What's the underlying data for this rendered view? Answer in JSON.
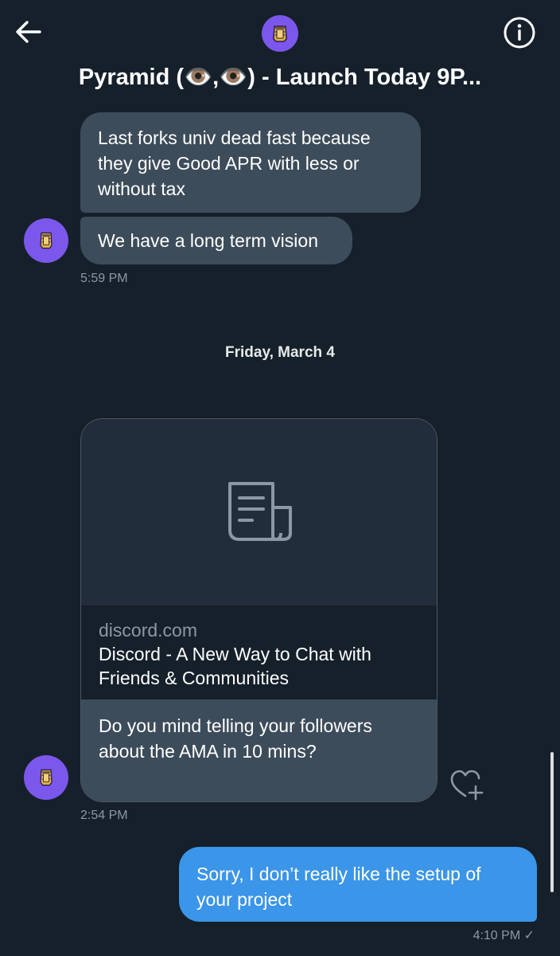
{
  "header": {
    "title": "Pyramid (👁️,👁️) - Launch Today 9P...",
    "back_icon": "arrow-left-icon",
    "info_icon": "info-icon"
  },
  "messages": {
    "m1_text": "Last forks univ dead fast because they give Good APR with less or without tax",
    "m2_text": "We have a long term vision",
    "m2_time": "5:59 PM",
    "day_separator": "Friday, March 4",
    "card": {
      "domain": "discord.com",
      "title": "Discord - A New Way to Chat with Friends & Communities",
      "message": "Do you mind telling your followers about the AMA in 10 mins?",
      "time": "2:54 PM",
      "icon": "document-icon"
    },
    "m3_text": "Sorry, I don’t really like the setup of your project",
    "m3_time": "4:10 PM ✓"
  },
  "colors": {
    "background": "#15202b",
    "incoming_bubble": "#3d4c5a",
    "outgoing_bubble": "#3b95e8",
    "avatar": "#7b57ec"
  }
}
